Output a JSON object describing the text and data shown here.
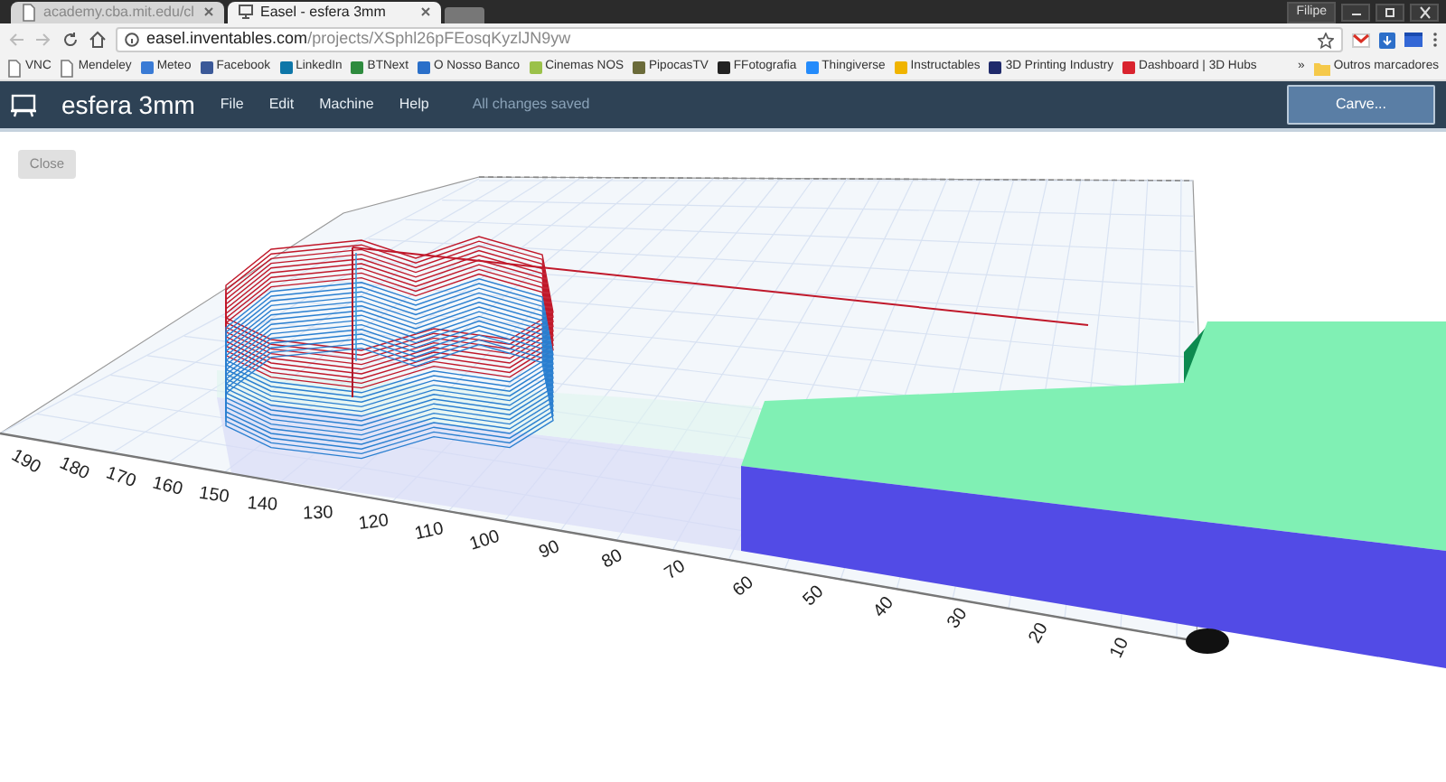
{
  "browser": {
    "tabs": [
      {
        "title": "academy.cba.mit.edu/cl",
        "selected": false
      },
      {
        "title": "Easel - esfera 3mm",
        "selected": true
      }
    ],
    "profile": "Filipe",
    "url_host": "easel.inventables.com",
    "url_path": "/projects/XSphl26pFEosqKyzlJN9yw",
    "bookmarks": [
      {
        "label": "VNC",
        "kind": "page"
      },
      {
        "label": "Mendeley",
        "kind": "page"
      },
      {
        "label": "Meteo",
        "kind": "site",
        "color": "#3a7bd5"
      },
      {
        "label": "Facebook",
        "kind": "site",
        "color": "#3b5998"
      },
      {
        "label": "LinkedIn",
        "kind": "site",
        "color": "#0e76a8"
      },
      {
        "label": "BTNext",
        "kind": "site",
        "color": "#2e8b3e"
      },
      {
        "label": "O Nosso Banco",
        "kind": "site",
        "color": "#2a6fc9"
      },
      {
        "label": "Cinemas NOS",
        "kind": "site",
        "color": "#9bc14a"
      },
      {
        "label": "PipocasTV",
        "kind": "site",
        "color": "#6b6b3a"
      },
      {
        "label": "FFotografia",
        "kind": "site",
        "color": "#222222"
      },
      {
        "label": "Thingiverse",
        "kind": "site",
        "color": "#248bfb"
      },
      {
        "label": "Instructables",
        "kind": "site",
        "color": "#f0b400"
      },
      {
        "label": "3D Printing Industry",
        "kind": "site",
        "color": "#1f2a6b"
      },
      {
        "label": "Dashboard | 3D Hubs",
        "kind": "site",
        "color": "#d9232e"
      }
    ],
    "overflow": "»",
    "other_bookmarks": "Outros marcadores"
  },
  "app": {
    "title": "esfera 3mm",
    "menu": [
      "File",
      "Edit",
      "Machine",
      "Help"
    ],
    "save_status": "All changes saved",
    "carve_button": "Carve...",
    "close_button": "Close"
  },
  "scene": {
    "axis_labels": [
      "190",
      "180",
      "170",
      "160",
      "150",
      "140",
      "130",
      "120",
      "110",
      "100",
      "90",
      "80",
      "70",
      "60",
      "50",
      "40",
      "30",
      "20",
      "10"
    ]
  }
}
